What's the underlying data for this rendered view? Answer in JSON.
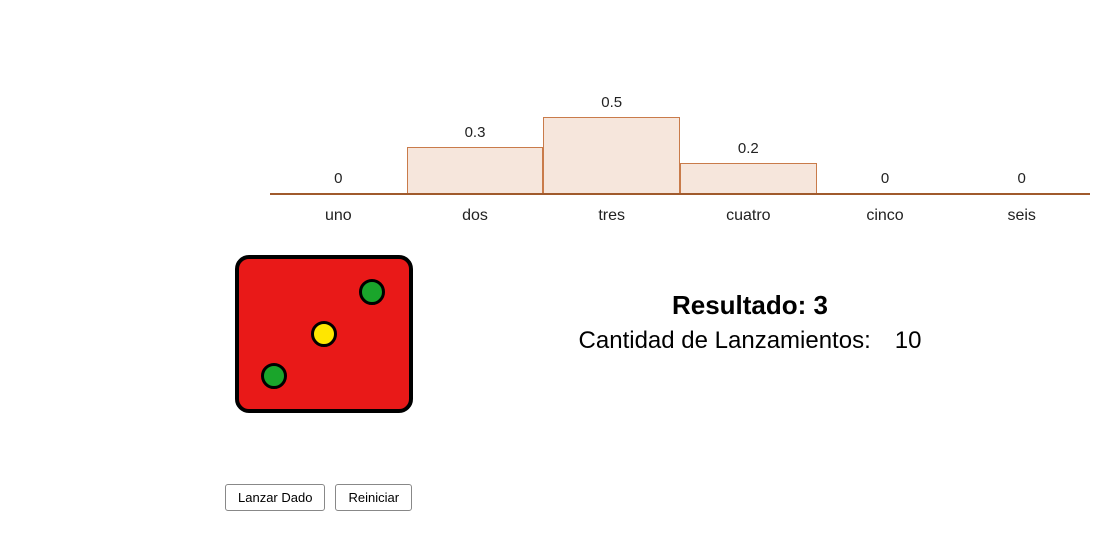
{
  "chart_data": {
    "type": "bar",
    "title": "",
    "xlabel": "",
    "ylabel": "",
    "ylim": [
      0,
      0.5
    ],
    "categories": [
      "uno",
      "dos",
      "tres",
      "cuatro",
      "cinco",
      "seis"
    ],
    "values": [
      0,
      0.3,
      0.5,
      0.2,
      0,
      0
    ],
    "value_labels": [
      "0",
      "0.3",
      "0.5",
      "0.2",
      "0",
      "0"
    ],
    "bar_fill": "#f6e6dc",
    "bar_stroke": "#c97b4a",
    "axis_stroke": "#a05a2c"
  },
  "die": {
    "face_value": 3,
    "body_color": "#e91918",
    "border_color": "#000000",
    "pips": [
      {
        "pos": "bottom-left",
        "color": "green"
      },
      {
        "pos": "center",
        "color": "yellow"
      },
      {
        "pos": "top-right",
        "color": "green"
      }
    ]
  },
  "result": {
    "label": "Resultado:",
    "value": "3"
  },
  "count": {
    "label": "Cantidad de Lanzamientos:",
    "value": "10"
  },
  "buttons": {
    "throw": "Lanzar Dado",
    "reset": "Reiniciar"
  }
}
